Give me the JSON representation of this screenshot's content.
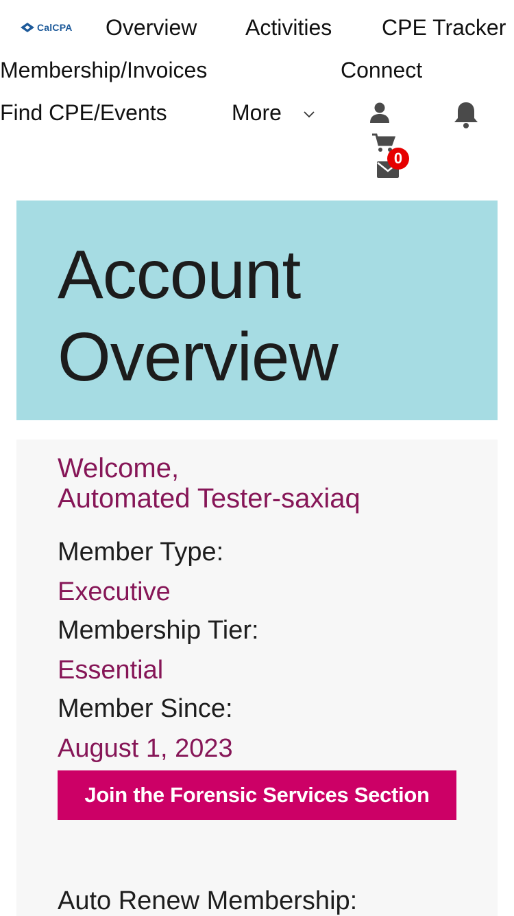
{
  "nav": {
    "logo_text": "CalCPA",
    "links": {
      "overview": "Overview",
      "activities": "Activities",
      "cpe_tracker": "CPE Tracker",
      "membership": "Membership/Invoices",
      "connect": "Connect",
      "find_cpe": "Find CPE/Events",
      "more": "More"
    },
    "icons": {
      "profile": "user-icon",
      "notifications": "bell-icon",
      "cart": "cart-icon",
      "messages": "envelope-icon",
      "more": "chevron-down-icon"
    },
    "cart_count": "0"
  },
  "hero": {
    "title": "Account Overview"
  },
  "account": {
    "welcome_line1": "Welcome,",
    "welcome_name": "Automated Tester-saxiaq",
    "member_type_label": "Member Type:",
    "member_type_value": "Executive",
    "membership_tier_label": "Membership Tier:",
    "membership_tier_value": "Essential",
    "member_since_label": "Member Since:",
    "member_since_value": "August 1, 2023",
    "join_button": "Join the Forensic Services Section",
    "auto_renew_label": "Auto Renew Membership:"
  },
  "colors": {
    "hero_bg": "#a6dce3",
    "accent_text": "#861657",
    "button_bg": "#cc0066",
    "badge": "#e60000",
    "logo_blue": "#1d5a9a"
  }
}
